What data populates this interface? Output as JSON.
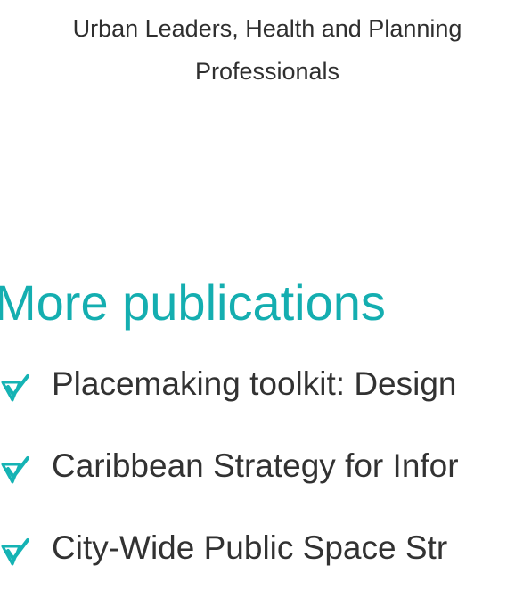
{
  "header": {
    "caption_line_1": "Urban Leaders, Health and Planning",
    "caption_line_2": "Professionals"
  },
  "publications": {
    "title": "More publications",
    "accent_color": "#14aeb0",
    "items": [
      {
        "icon": "check-icon",
        "title": "Placemaking toolkit: Design"
      },
      {
        "icon": "check-icon",
        "title": "Caribbean Strategy for Infor"
      },
      {
        "icon": "check-icon",
        "title": "City-Wide Public Space Str"
      }
    ]
  }
}
